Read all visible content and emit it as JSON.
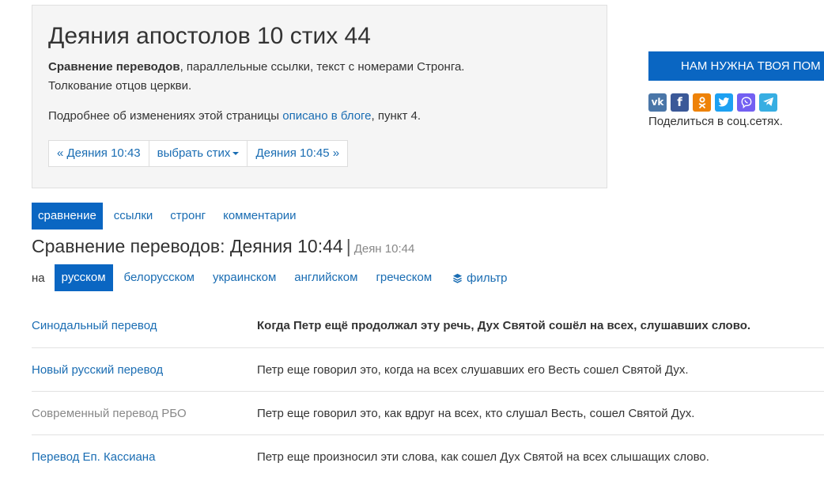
{
  "header": {
    "title": "Деяния апостолов 10 стих 44",
    "desc_bold": "Сравнение переводов",
    "desc_rest": ", параллельные ссылки, текст с номерами Стронга.",
    "desc_line2": "Толкование отцов церкви.",
    "more_prefix": "Подробнее об изменениях этой страницы ",
    "more_link": "описано в блоге",
    "more_suffix": ", пункт 4."
  },
  "pager": {
    "prev": "« Деяния 10:43",
    "select": "выбрать стих",
    "next": "Деяния 10:45 »"
  },
  "sidebar": {
    "donate": "НАМ НУЖНА ТВОЯ ПОМ",
    "share_label": "Поделиться в соц.сетях."
  },
  "social": [
    {
      "name": "vk-icon",
      "glyph": "vk",
      "color": "#4a76a8"
    },
    {
      "name": "facebook-icon",
      "glyph": "f",
      "color": "#3b5998"
    },
    {
      "name": "odnoklassniki-icon",
      "glyph": "ok",
      "color": "#ee8208"
    },
    {
      "name": "twitter-icon",
      "glyph": "tw",
      "color": "#1da1f2"
    },
    {
      "name": "viber-icon",
      "glyph": "vb",
      "color": "#7360f2"
    },
    {
      "name": "telegram-icon",
      "glyph": "tg",
      "color": "#37aee2"
    }
  ],
  "tabs": [
    {
      "label": "сравнение",
      "active": true
    },
    {
      "label": "ссылки"
    },
    {
      "label": "стронг"
    },
    {
      "label": "комментарии"
    }
  ],
  "section": {
    "title": "Сравнение переводов: Деяния 10:44",
    "separator": "|",
    "ref": "Деян 10:44"
  },
  "languages": {
    "prefix": "на",
    "items": [
      {
        "label": "русском",
        "active": true
      },
      {
        "label": "белорусском"
      },
      {
        "label": "украинском"
      },
      {
        "label": "английском"
      },
      {
        "label": "греческом"
      }
    ],
    "filter": "фильтр"
  },
  "translations": [
    {
      "name": "Синодальный перевод",
      "text": "Когда Петр ещё продолжал эту речь, Дух Святой сошёл на всех, слушавших слово.",
      "bold": true
    },
    {
      "name": "Новый русский перевод",
      "text": "Петр еще говорил это, когда на всех слушавших его Весть сошел Святой Дух."
    },
    {
      "name": "Современный перевод РБО",
      "text": "Петр еще говорил это, как вдруг на всех, кто слушал Весть, сошел Святой Дух.",
      "muted": true
    },
    {
      "name": "Перевод Еп. Кассиана",
      "text": "Петр еще произносил эти слова, как сошел Дух Святой на всех слышащих слово."
    }
  ]
}
